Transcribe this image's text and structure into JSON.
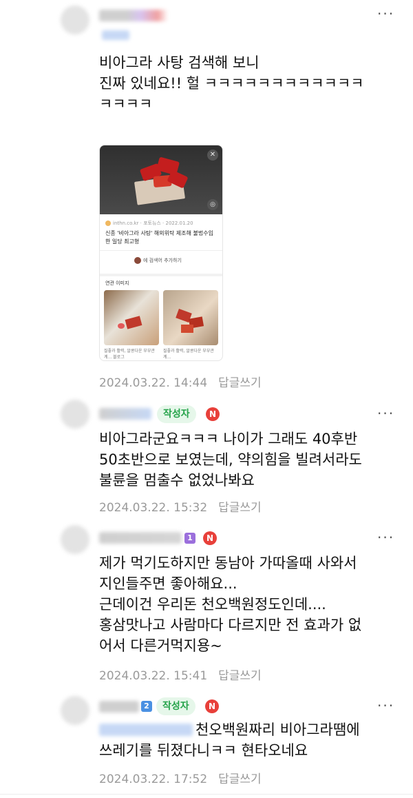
{
  "comments": [
    {
      "text": "비아그라 사탕 검색해 보니\n진짜 있네요!! 헐 ㅋㅋㅋㅋㅋㅋㅋㅋㅋㅋㅋㅋ\nㅋㅋㅋㅋ",
      "date": "2024.03.22. 14:44",
      "reply": "답글쓰기",
      "embed": {
        "source": "inthn.co.kr · 포토뉴스 · 2022.01.20",
        "headline": "신종 '비아그라 사탕' 해외위탁 제조해 불법수입한 일당 최고형",
        "add_label": "에 검색어 추가하기",
        "related_label": "연관 이미지",
        "caption1": "질좋과 활력, 알콩다운 부부관계... 블로그",
        "caption2": "질좋과 활력, 알콩다운 부부관계..."
      }
    },
    {
      "author_badge": "작성자",
      "n_badge": "N",
      "text": "비아그라군요ㅋㅋㅋ 나이가 그래도 40후반\n50초반으로 보였는데, 약의힘을 빌려서라도\n불륜을 멈출수 없었나봐요",
      "date": "2024.03.22. 15:32",
      "reply": "답글쓰기"
    },
    {
      "n_badge": "N",
      "level_badge": "1",
      "text": "제가 먹기도하지만 동남아 가따올때 사와서\n지인들주면 좋아해요...\n근데이건 우리돈 천오백원정도인데....\n홍삼맛나고 사람마다 다르지만 전 효과가 없\n어서 다른거먹지용~",
      "date": "2024.03.22. 15:41",
      "reply": "답글쓰기"
    },
    {
      "author_badge": "작성자",
      "n_badge": "N",
      "level_badge": "2",
      "text": "천오백원짜리 비아그라땜에\n쓰레기를 뒤졌다니ㅋㅋ 현타오네요",
      "date": "2024.03.22. 17:52",
      "reply": "답글쓰기"
    }
  ],
  "more_icon": "···",
  "colors": {
    "author_badge_bg": "#e6f7ea",
    "author_badge_fg": "#25a34a",
    "n_badge": "#e8403a",
    "meta": "#9a9a9a"
  }
}
